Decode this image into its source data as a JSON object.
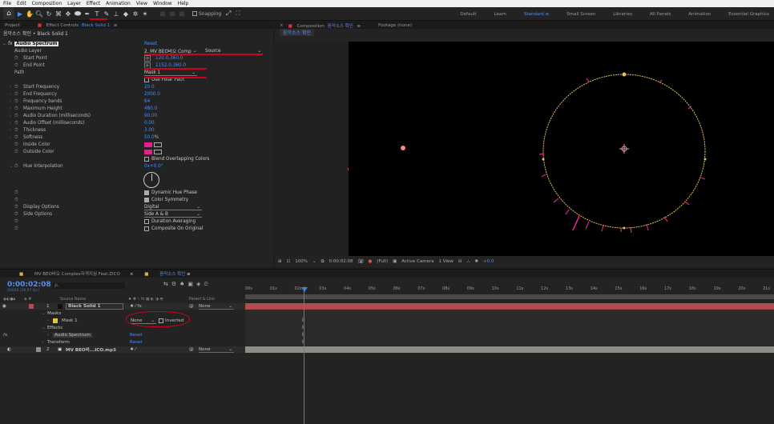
{
  "menu": [
    "File",
    "Edit",
    "Composition",
    "Layer",
    "Effect",
    "Animation",
    "View",
    "Window",
    "Help"
  ],
  "toolbar": {
    "snapping_label": "Snapping"
  },
  "workspaces": [
    {
      "label": "Default",
      "active": false
    },
    {
      "label": "Learn",
      "active": false
    },
    {
      "label": "Standard",
      "active": true
    },
    {
      "label": "Small Screen",
      "active": false
    },
    {
      "label": "Libraries",
      "active": false
    },
    {
      "label": "All Panels",
      "active": false
    },
    {
      "label": "Animation",
      "active": false
    },
    {
      "label": "Essential Graphics",
      "active": false
    }
  ],
  "effect_controls": {
    "project_tab": "Project",
    "tab_prefix": "Effect Controls",
    "tab_layer": "Black Solid 1",
    "subtitle": "음악소스 확인 • Black Solid 1",
    "effect_name": "Audio Spectrum",
    "reset": "Reset",
    "audio_layer_label": "Audio Layer",
    "audio_layer_value": "2. MV BEO비오 Comp",
    "audio_layer_source": "Source",
    "start_point_label": "Start Point",
    "start_point_value": "120.0,360.0",
    "end_point_label": "End Point",
    "end_point_value": "1152.0,360.0",
    "path_label": "Path",
    "path_value": "Mask 1",
    "use_polar_path": "Use Polar Path",
    "start_freq_label": "Start Frequency",
    "start_freq_value": "20.0",
    "end_freq_label": "End Frequency",
    "end_freq_value": "2000.0",
    "freq_bands_label": "Frequency bands",
    "freq_bands_value": "64",
    "max_height_label": "Maximum Height",
    "max_height_value": "480.0",
    "audio_duration_label": "Audio Duration (milliseconds)",
    "audio_duration_value": "90.00",
    "audio_offset_label": "Audio Offset (milliseconds)",
    "audio_offset_value": "0.00",
    "thickness_label": "Thickness",
    "thickness_value": "3.00",
    "softness_label": "Softness",
    "softness_value": "50.0",
    "softness_unit": "%",
    "inside_color_label": "Inside Color",
    "outside_color_label": "Outside Color",
    "blend_overlapping": "Blend Overlapping Colors",
    "hue_interp_label": "Hue Interpolation",
    "hue_interp_value": "0x+0.0°",
    "dynamic_hue": "Dynamic Hue Phase",
    "color_symmetry": "Color Symmetry",
    "display_options_label": "Display Options",
    "display_options_value": "Digital",
    "side_options_label": "Side Options",
    "side_options_value": "Side A & B",
    "duration_averaging": "Duration Averaging",
    "composite_on_original": "Composite On Original",
    "swatch_color": "#e91e8c"
  },
  "composition": {
    "tab_prefix": "Composition",
    "tab_name": "음악소스 확인",
    "footage_tab": "Footage (none)",
    "sub_tab": "음악소스 확인",
    "zoom": "100%",
    "timecode": "0:00:02:08",
    "resolution": "(Full)",
    "camera": "Active Camera",
    "views": "1 View",
    "exposure": "+0.0"
  },
  "timeline": {
    "tab1": "MV BEO비오 Complex자격지심 Feat.ZICO",
    "tab2": "음악소스 확인",
    "timecode": "0:00:02:08",
    "fps": "00068 (29.97 fps)",
    "search_placeholder": "ρ.",
    "col_source": "Source Name",
    "col_parent": "Parent & Link",
    "ruler": [
      "00s",
      "01s",
      "02s",
      "03s",
      "04s",
      "05s",
      "06s",
      "07s",
      "08s",
      "09s",
      "10s",
      "11s",
      "12s",
      "13s",
      "14s",
      "15s",
      "16s",
      "17s",
      "18s",
      "19s",
      "20s",
      "21s"
    ],
    "layer1_num": "1",
    "layer1_name": "Black Solid 1",
    "parent_none": "None",
    "masks_label": "Masks",
    "mask1_label": "Mask 1",
    "mask_mode": "None",
    "inverted": "Inverted",
    "effects_label": "Effects",
    "audio_spectrum_label": "Audio Spectrum",
    "reset": "Reset",
    "transform_label": "Transform",
    "layer2_num": "2",
    "layer2_name": "MV BEO비...ICO.mp3",
    "layer1_color": "#b24a50",
    "layer2_color": "#8a8f86"
  }
}
